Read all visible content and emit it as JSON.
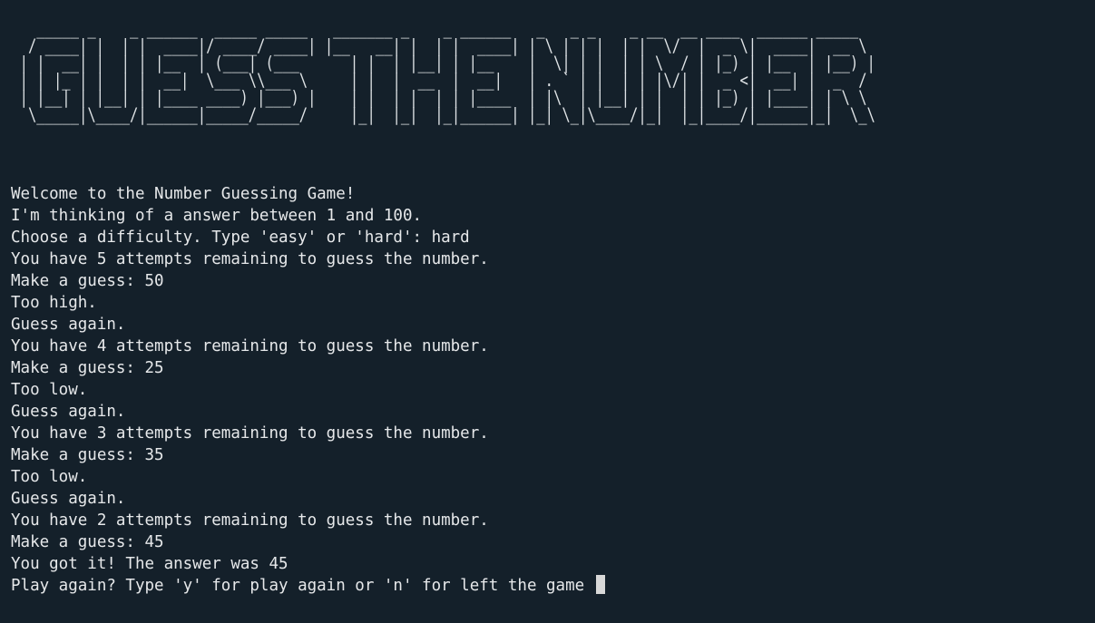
{
  "banner": {
    "art": "  _____ _    _ ______  _____ _____   _______ _    _ ______   _   _ _    _ __  __ ____  ______ _____  \n / ____| |  | |  ____|/ ____/ ____| |__   __| |  | |  ____| | \\ | | |  | |  \\/  |  _ \\|  ____|  __ \\ \n| |  __| |  | | |__  | (___| (___      | |  | |__| | |__    |  \\| | |  | | \\  / | |_) | |__  | |__) |\n| | |_ | |  | |  __|  \\___ \\\\___ \\     | |  |  __  |  __|   | . ` | |  | | |\\/| |  _ <|  __| |  _  / \n| |__| | |__| | |____ ____) |___) |    | |  | |  | | |____  | |\\  | |__| | |  | | |_) | |____| | \\ \\ \n \\_____|\\____/|______|_____/_____/     |_|  |_|  |_|______| |_| \\_|\\____/|_|  |_|____/|______|_|  \\_\\"
  },
  "lines": [
    "Welcome to the Number Guessing Game!",
    "I'm thinking of a answer between 1 and 100.",
    "Choose a difficulty. Type 'easy' or 'hard': hard",
    "You have 5 attempts remaining to guess the number.",
    "Make a guess: 50",
    "Too high.",
    "Guess again.",
    "You have 4 attempts remaining to guess the number.",
    "Make a guess: 25",
    "Too low.",
    "Guess again.",
    "You have 3 attempts remaining to guess the number.",
    "Make a guess: 35",
    "Too low.",
    "Guess again.",
    "You have 2 attempts remaining to guess the number.",
    "Make a guess: 45",
    "You got it! The answer was 45"
  ],
  "prompt": "Play again? Type 'y' for play again or 'n' for left the game ",
  "colors": {
    "background": "#14202a",
    "text": "#e6e8ea",
    "cursor": "#d8d8d8"
  }
}
